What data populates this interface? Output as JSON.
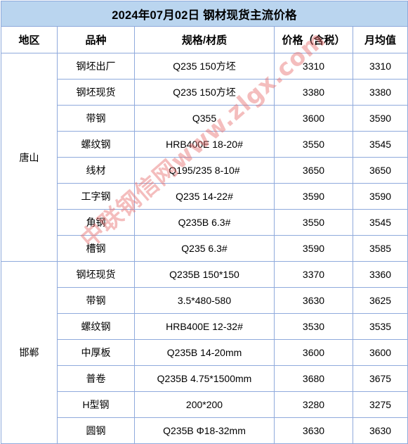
{
  "table": {
    "title": "2024年07月02日 钢材现货主流价格",
    "columns": [
      "地区",
      "品种",
      "规格/材质",
      "价格（含税）",
      "月均值"
    ],
    "rows": [
      {
        "region": "唐山",
        "region_rowspan": 8,
        "variety": "钢坯出厂",
        "spec": "Q235 150方坯",
        "price": "3310",
        "avg": "3310"
      },
      {
        "region": "",
        "variety": "钢坯现货",
        "spec": "Q235 150方坯",
        "price": "3380",
        "avg": "3380"
      },
      {
        "region": "",
        "variety": "带钢",
        "spec": "Q355",
        "price": "3600",
        "avg": "3590"
      },
      {
        "region": "",
        "variety": "螺纹钢",
        "spec": "HRB400E  18-20#",
        "price": "3550",
        "avg": "3545"
      },
      {
        "region": "",
        "variety": "线材",
        "spec": "Q195/235  8-10#",
        "price": "3650",
        "avg": "3650"
      },
      {
        "region": "",
        "variety": "工字钢",
        "spec": "Q235  14-22#",
        "price": "3590",
        "avg": "3590"
      },
      {
        "region": "",
        "variety": "角钢",
        "spec": "Q235B 6.3#",
        "price": "3550",
        "avg": "3545"
      },
      {
        "region": "",
        "variety": "槽钢",
        "spec": "Q235  6.3#",
        "price": "3590",
        "avg": "3585"
      },
      {
        "region": "邯郸",
        "region_rowspan": 7,
        "variety": "钢坯现货",
        "spec": "Q235B 150*150",
        "price": "3370",
        "avg": "3360"
      },
      {
        "region": "",
        "variety": "带钢",
        "spec": "3.5*480-580",
        "price": "3630",
        "avg": "3625"
      },
      {
        "region": "",
        "variety": "螺纹钢",
        "spec": "HRB400E 12-32#",
        "price": "3530",
        "avg": "3535"
      },
      {
        "region": "",
        "variety": "中厚板",
        "spec": "Q235B  14-20mm",
        "price": "3600",
        "avg": "3600"
      },
      {
        "region": "",
        "variety": "普卷",
        "spec": "Q235B 4.75*1500mm",
        "price": "3680",
        "avg": "3675"
      },
      {
        "region": "",
        "variety": "H型钢",
        "spec": "200*200",
        "price": "3280",
        "avg": "3275"
      },
      {
        "region": "",
        "variety": "圆钢",
        "spec": "Q235B Φ18-32mm",
        "price": "3630",
        "avg": "3630"
      }
    ]
  },
  "watermark": {
    "text": "中联钢信网www.zlgx.com",
    "color": "#e76c6c"
  },
  "colors": {
    "title_background": "#bad5ef",
    "border": "#8faadc",
    "text": "#000000",
    "cell_background": "#ffffff"
  }
}
